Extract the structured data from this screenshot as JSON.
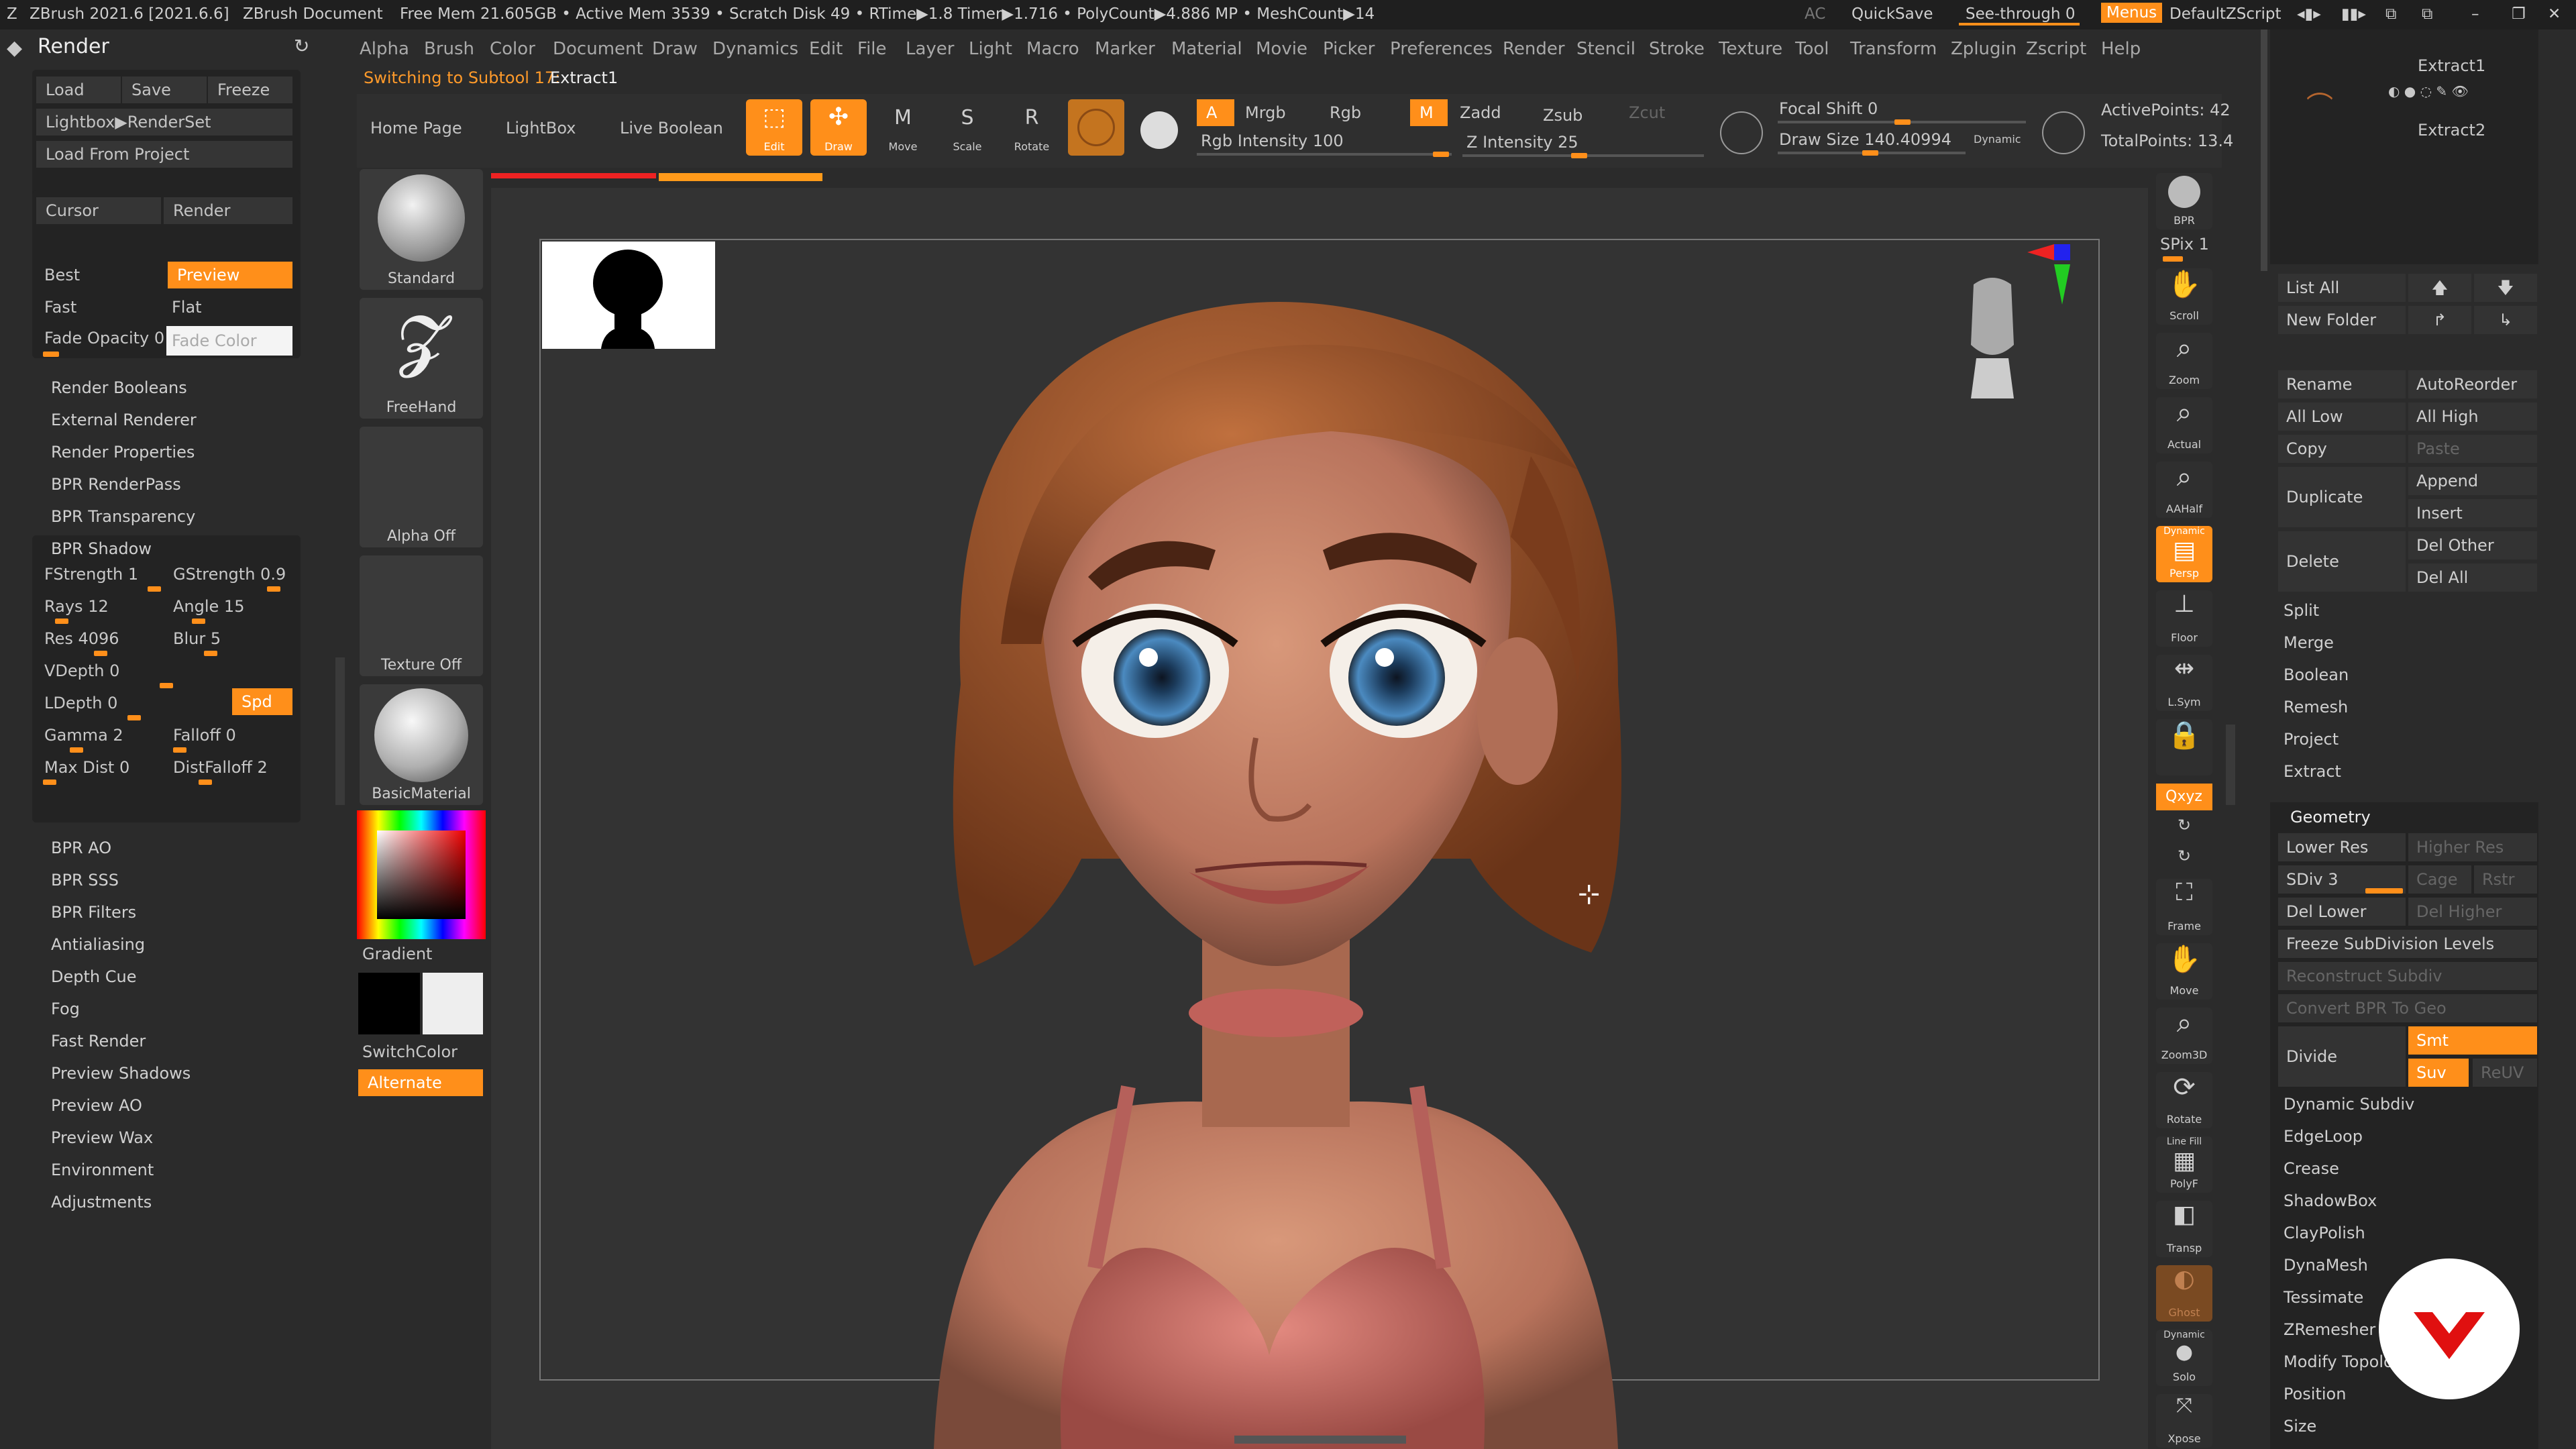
{
  "titlebar": {
    "app": "ZBrush 2021.6 [2021.6.6]",
    "doc": "ZBrush Document",
    "stats": "Free Mem 21.605GB • Active Mem 3539 • Scratch Disk 49 • RTime▶1.8 Timer▶1.716 • PolyCount▶4.886 MP • MeshCount▶14",
    "ac": "AC",
    "quicksave": "QuickSave",
    "seethrough": "See-through  0",
    "menus": "Menus",
    "zscript": "DefaultZScript"
  },
  "menus": [
    "Alpha",
    "Brush",
    "Color",
    "Document",
    "Draw",
    "Dynamics",
    "Edit",
    "File",
    "Layer",
    "Light",
    "Macro",
    "Marker",
    "Material",
    "Movie",
    "Picker",
    "Preferences",
    "Render",
    "Stencil",
    "Stroke",
    "Texture",
    "Tool",
    "Transform",
    "Zplugin",
    "Zscript",
    "Help"
  ],
  "left_panel": {
    "title": "Render",
    "load": "Load",
    "save": "Save",
    "freeze": "Freeze",
    "lightbox": "Lightbox▶RenderSet",
    "load_project": "Load From Project",
    "cursor": "Cursor",
    "render": "Render",
    "best": "Best",
    "preview": "Preview",
    "fast": "Fast",
    "flat": "Flat",
    "fade_opacity": "Fade Opacity 0",
    "fade_color": "Fade Color",
    "items1": [
      "Render Booleans",
      "External Renderer",
      "Render Properties",
      "BPR RenderPass",
      "BPR Transparency",
      "BPR Shadow"
    ],
    "shadow": {
      "fstrength": "FStrength 1",
      "gstrength": "GStrength 0.9",
      "rays": "Rays 12",
      "angle": "Angle 15",
      "res": "Res 4096",
      "blur": "Blur 5",
      "vdepth": "VDepth 0",
      "ldepth": "LDepth 0",
      "spd": "Spd",
      "gamma": "Gamma 2",
      "falloff": "Falloff 0",
      "maxdist": "Max Dist 0",
      "distfalloff": "DistFalloff 2"
    },
    "items2": [
      "BPR AO",
      "BPR SSS",
      "BPR Filters",
      "Antialiasing",
      "Depth Cue",
      "Fog",
      "Fast Render",
      "Preview Shadows",
      "Preview AO",
      "Preview Wax",
      "Environment",
      "Adjustments"
    ]
  },
  "status": {
    "prefix": "Switching to Subtool 17:",
    "name": "Extract1"
  },
  "top_shelf": {
    "home": "Home Page",
    "lightbox": "LightBox",
    "live_boolean": "Live Boolean",
    "edit": "Edit",
    "draw": "Draw",
    "move": "Move",
    "scale": "Scale",
    "rotate": "Rotate",
    "a": "A",
    "mrgb": "Mrgb",
    "rgb": "Rgb",
    "m": "M",
    "zadd": "Zadd",
    "zsub": "Zsub",
    "zcut": "Zcut",
    "rgb_intensity": "Rgb Intensity 100",
    "z_intensity": "Z Intensity 25",
    "focal_shift": "Focal Shift 0",
    "draw_size": "Draw Size 140.40994",
    "dynamic": "Dynamic",
    "active_points": "ActivePoints: 42",
    "total_points": "TotalPoints: 13.4"
  },
  "brush_shelf": {
    "standard": "Standard",
    "freehand": "FreeHand",
    "alpha": "Alpha Off",
    "texture": "Texture Off",
    "material": "BasicMaterial",
    "gradient": "Gradient",
    "switchcolor": "SwitchColor",
    "alternate": "Alternate"
  },
  "right_tools": {
    "bpr": "BPR",
    "spix": "SPix 1",
    "scroll": "Scroll",
    "zoom": "Zoom",
    "actual": "Actual",
    "aahalf": "AAHalf",
    "dynamic": "Dynamic",
    "persp": "Persp",
    "floor": "Floor",
    "lsym": "L.Sym",
    "xyz": "Qxyz",
    "frame": "Frame",
    "move": "Move",
    "zoom3d": "Zoom3D",
    "rotate": "Rotate",
    "linefill": "Line Fill",
    "polyf": "PolyF",
    "transp": "Transp",
    "ghost": "Ghost",
    "solo": "Solo",
    "xpose": "Xpose"
  },
  "subtool": {
    "extract1": "Extract1",
    "extract2": "Extract2",
    "list_all": "List All",
    "new_folder": "New Folder",
    "rename": "Rename",
    "autoreorder": "AutoReorder",
    "all_low": "All Low",
    "all_high": "All High",
    "copy": "Copy",
    "paste": "Paste",
    "duplicate": "Duplicate",
    "append": "Append",
    "insert": "Insert",
    "delete": "Delete",
    "del_other": "Del Other",
    "del_all": "Del All",
    "items": [
      "Split",
      "Merge",
      "Boolean",
      "Remesh",
      "Project",
      "Extract"
    ]
  },
  "geometry": {
    "title": "Geometry",
    "lower_res": "Lower Res",
    "higher_res": "Higher Res",
    "sdiv": "SDiv 3",
    "cage": "Cage",
    "rstr": "Rstr",
    "del_lower": "Del Lower",
    "del_higher": "Del Higher",
    "freeze": "Freeze SubDivision Levels",
    "reconstruct": "Reconstruct Subdiv",
    "convert": "Convert BPR To Geo",
    "divide": "Divide",
    "smt": "Smt",
    "suv": "Suv",
    "reuv": "ReUV",
    "items": [
      "Dynamic Subdiv",
      "EdgeLoop",
      "Crease",
      "ShadowBox",
      "ClayPolish",
      "DynaMesh",
      "Tessimate",
      "ZRemesher",
      "Modify Topolo",
      "Position",
      "Size"
    ]
  },
  "colors": {
    "accent": "#ff8f1a",
    "panel": "#232323",
    "bg": "#2b2b2b",
    "canvas": "#333333"
  }
}
